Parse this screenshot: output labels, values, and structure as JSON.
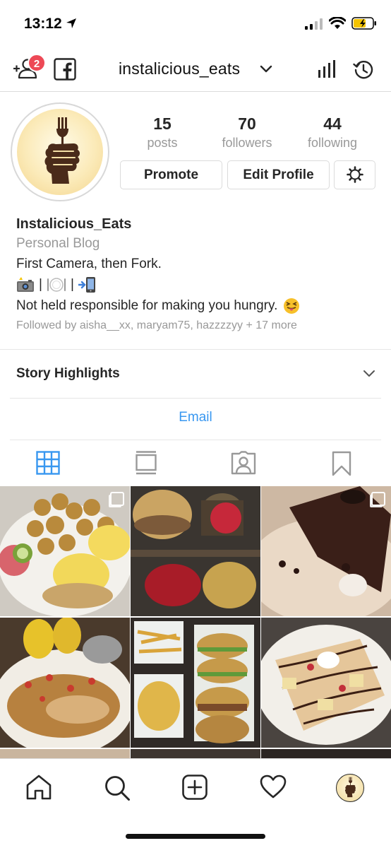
{
  "status_bar": {
    "time": "13:12"
  },
  "top_nav": {
    "username": "instalicious_eats",
    "notification_count": "2",
    "icons": [
      "add-user-icon",
      "facebook-icon",
      "chevron-down-icon",
      "insights-icon",
      "archive-history-icon"
    ]
  },
  "profile": {
    "counts": [
      {
        "value": "15",
        "label": "posts"
      },
      {
        "value": "70",
        "label": "followers"
      },
      {
        "value": "44",
        "label": "following"
      }
    ],
    "buttons": {
      "promote": "Promote",
      "edit_profile": "Edit Profile"
    },
    "name": "Instalicious_Eats",
    "category": "Personal Blog",
    "bio_line1": "First Camera, then Fork.",
    "bio_emojis": [
      "camera-flash-icon",
      "plate-cutlery-icon",
      "phone-arrow-icon"
    ],
    "bio_separator": "|",
    "bio_line3": "Not held responsible for making you hungry.",
    "followed_by": "Followed by aisha__xx, maryam75, hazzzzyy + 17 more"
  },
  "story_highlights": {
    "label": "Story Highlights"
  },
  "contact": {
    "email_label": "Email"
  },
  "tabs": [
    {
      "name": "grid",
      "active": true
    },
    {
      "name": "feed",
      "active": false
    },
    {
      "name": "tagged",
      "active": false
    },
    {
      "name": "saved",
      "active": false
    }
  ],
  "posts": [
    {
      "subject": "eggs benedict with potatoes",
      "multiple": true
    },
    {
      "subject": "burgers",
      "multiple": false
    },
    {
      "subject": "chocolate cake",
      "multiple": true
    },
    {
      "subject": "rice with corn",
      "multiple": false
    },
    {
      "subject": "fries and burgers",
      "multiple": false
    },
    {
      "subject": "crepe dessert",
      "multiple": false
    }
  ],
  "bottom_nav": [
    "home-icon",
    "search-icon",
    "new-post-icon",
    "activity-heart-icon",
    "profile-avatar-icon"
  ],
  "colors": {
    "accent_blue": "#3897f0",
    "badge_red": "#ed4956",
    "muted_text": "#999999",
    "border": "#dbdbdb"
  }
}
